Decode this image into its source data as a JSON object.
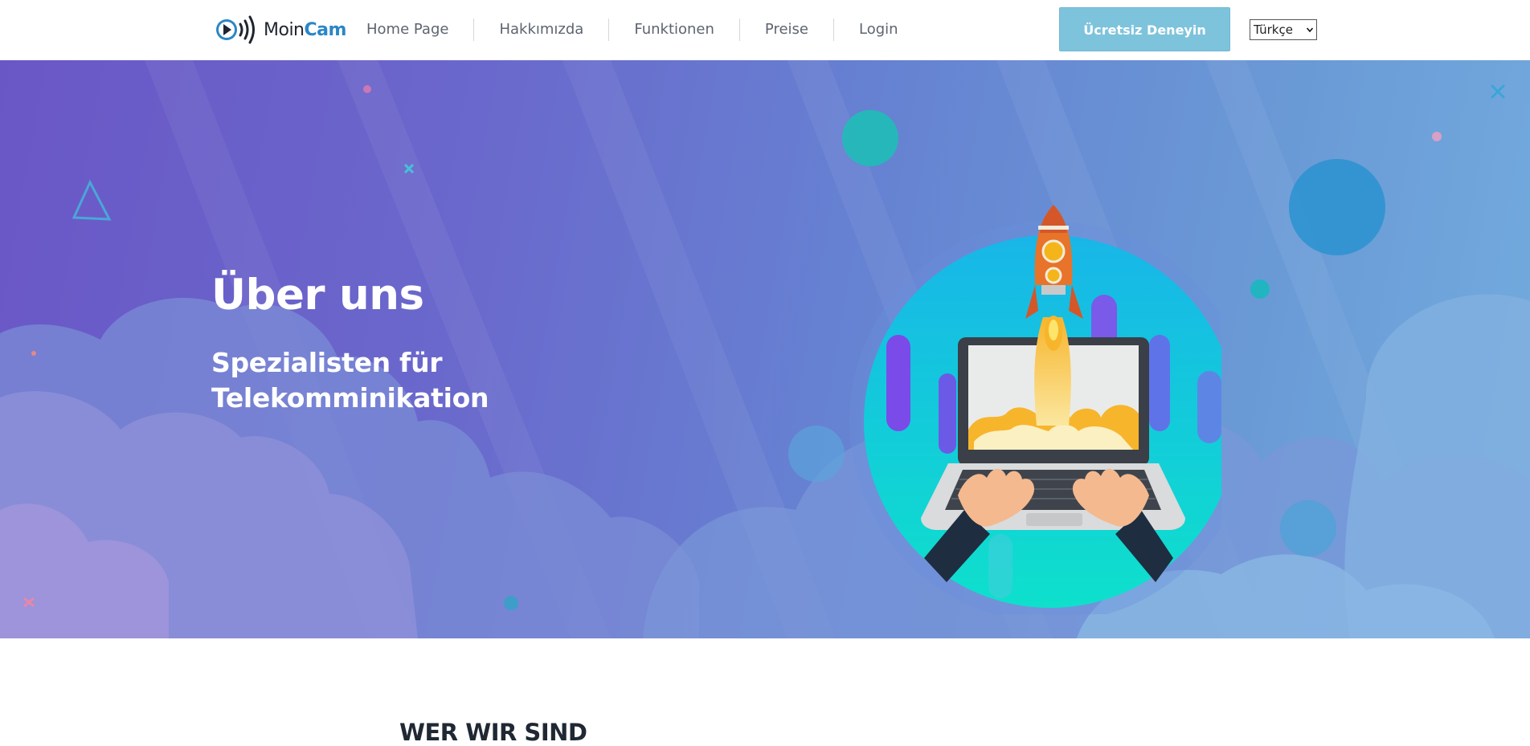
{
  "header": {
    "logo": {
      "part1": "Moin",
      "part2": "Cam"
    },
    "nav": [
      {
        "label": "Home Page"
      },
      {
        "label": "Hakkımızda"
      },
      {
        "label": "Funktionen"
      },
      {
        "label": "Preise"
      },
      {
        "label": "Login"
      }
    ],
    "cta_label": "Ücretsiz Deneyin",
    "language": {
      "selected": "Türkçe"
    }
  },
  "hero": {
    "title": "Über uns",
    "subtitle_line1": "Spezialisten für",
    "subtitle_line2": "Telekomminikation",
    "close_icon": "close-icon",
    "illustration_icon": "rocket-laptop-illustration"
  },
  "section": {
    "title": "WER WIR SIND"
  },
  "colors": {
    "brand": "#2a86c7",
    "cta": "#7ec3dc",
    "hero_start": "#6a57c6",
    "hero_end": "#73acde"
  }
}
